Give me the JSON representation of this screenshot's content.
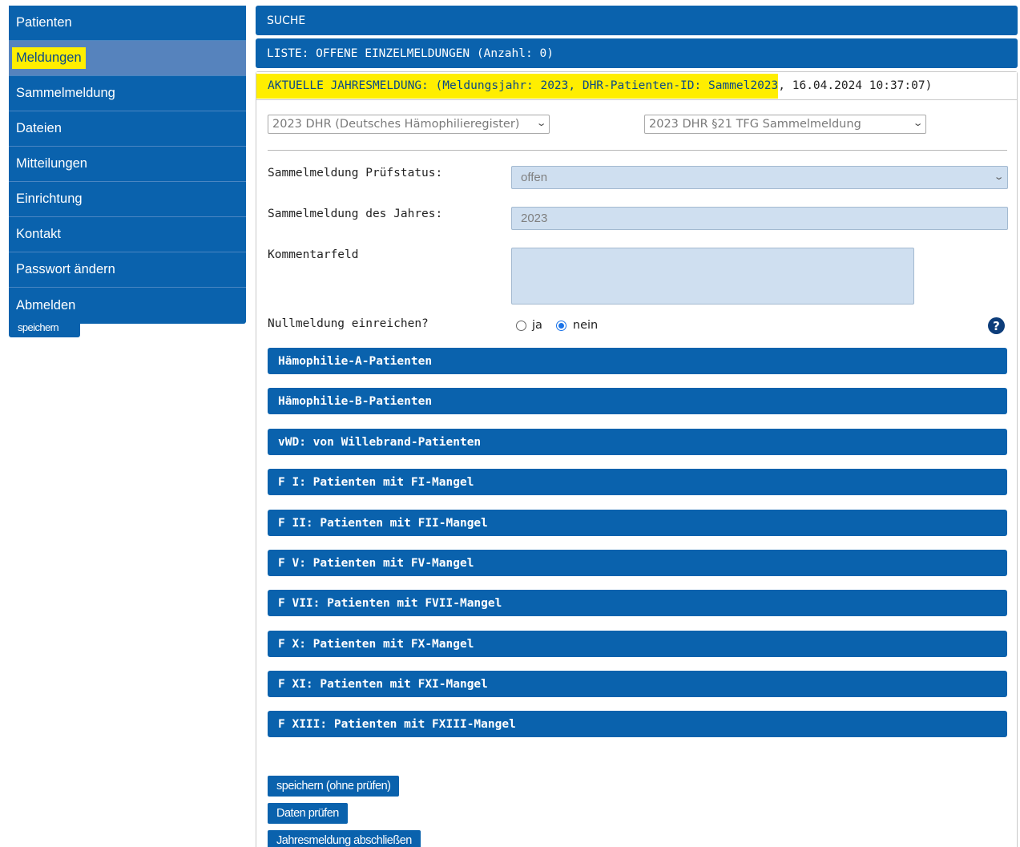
{
  "sidebar": {
    "items": [
      {
        "label": "Patienten"
      },
      {
        "label": "Meldungen"
      },
      {
        "label": "Sammelmeldung"
      },
      {
        "label": "Dateien"
      },
      {
        "label": "Mitteilungen"
      },
      {
        "label": "Einrichtung"
      },
      {
        "label": "Kontakt"
      },
      {
        "label": "Passwort ändern"
      },
      {
        "label": "Abmelden"
      }
    ],
    "save_label": "speichern"
  },
  "main": {
    "search_bar": "SUCHE",
    "list_bar": "LISTE: OFFENE EINZELMELDUNGEN (Anzahl: 0)",
    "panel_title_highlight": "AKTUELLE JAHRESMELDUNG: (Meldungsjahr: 2023, DHR-Patienten-ID: Sammel2023",
    "panel_title_rest": ", 16.04.2024 10:37:07)",
    "register_select": "2023 DHR (Deutsches Hämophilieregister)",
    "type_select": "2023 DHR §21 TFG Sammelmeldung",
    "fields": {
      "status_label": "Sammelmeldung Prüfstatus:",
      "status_value": "offen",
      "year_label": "Sammelmeldung des Jahres:",
      "year_value": "2023",
      "comment_label": "Kommentarfeld",
      "comment_value": "",
      "null_label": "Nullmeldung einreichen?",
      "null_yes": "ja",
      "null_no": "nein",
      "null_selected": "nein",
      "help": "?"
    },
    "categories": [
      "Hämophilie-A-Patienten",
      "Hämophilie-B-Patienten",
      "vWD: von Willebrand-Patienten",
      "F I: Patienten mit FI-Mangel",
      "F II: Patienten mit FII-Mangel",
      "F V: Patienten mit FV-Mangel",
      "F VII: Patienten mit FVII-Mangel",
      "F X: Patienten mit FX-Mangel",
      "F XI: Patienten mit FXI-Mangel",
      "F XIII: Patienten mit FXIII-Mangel"
    ],
    "buttons": {
      "save_no_check": "speichern (ohne prüfen)",
      "check": "Daten prüfen",
      "finish": "Jahresmeldung abschließen"
    }
  },
  "colors": {
    "primary_blue": "#0a62ad",
    "active_nav": "#5683bd",
    "highlight_yellow": "#ffee00",
    "field_bg": "#cfdff0"
  }
}
